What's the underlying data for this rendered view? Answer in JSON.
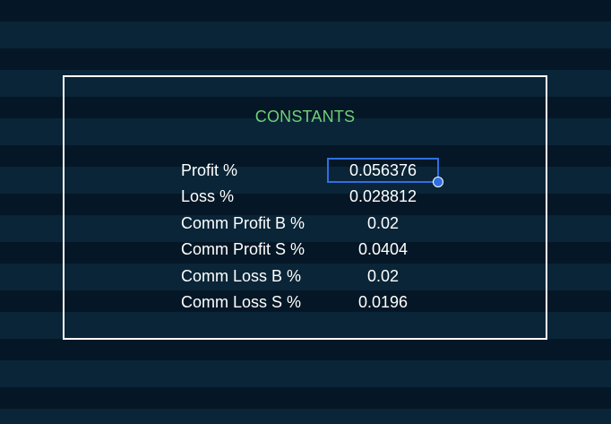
{
  "panel": {
    "title": "CONSTANTS",
    "rows": [
      {
        "label": "Profit %",
        "value": "0.056376"
      },
      {
        "label": "Loss %",
        "value": "0.028812"
      },
      {
        "label": "Comm Profit B %",
        "value": "0.02"
      },
      {
        "label": "Comm Profit S %",
        "value": "0.0404"
      },
      {
        "label": "Comm Loss B %",
        "value": "0.02"
      },
      {
        "label": "Comm Loss S %",
        "value": "0.0196"
      }
    ]
  },
  "colors": {
    "background_dark": "#051726",
    "background_stripe": "#0a2537",
    "title_green": "#6fcf7a",
    "selection_blue": "#2f6fe0",
    "panel_border": "#ffffff"
  }
}
